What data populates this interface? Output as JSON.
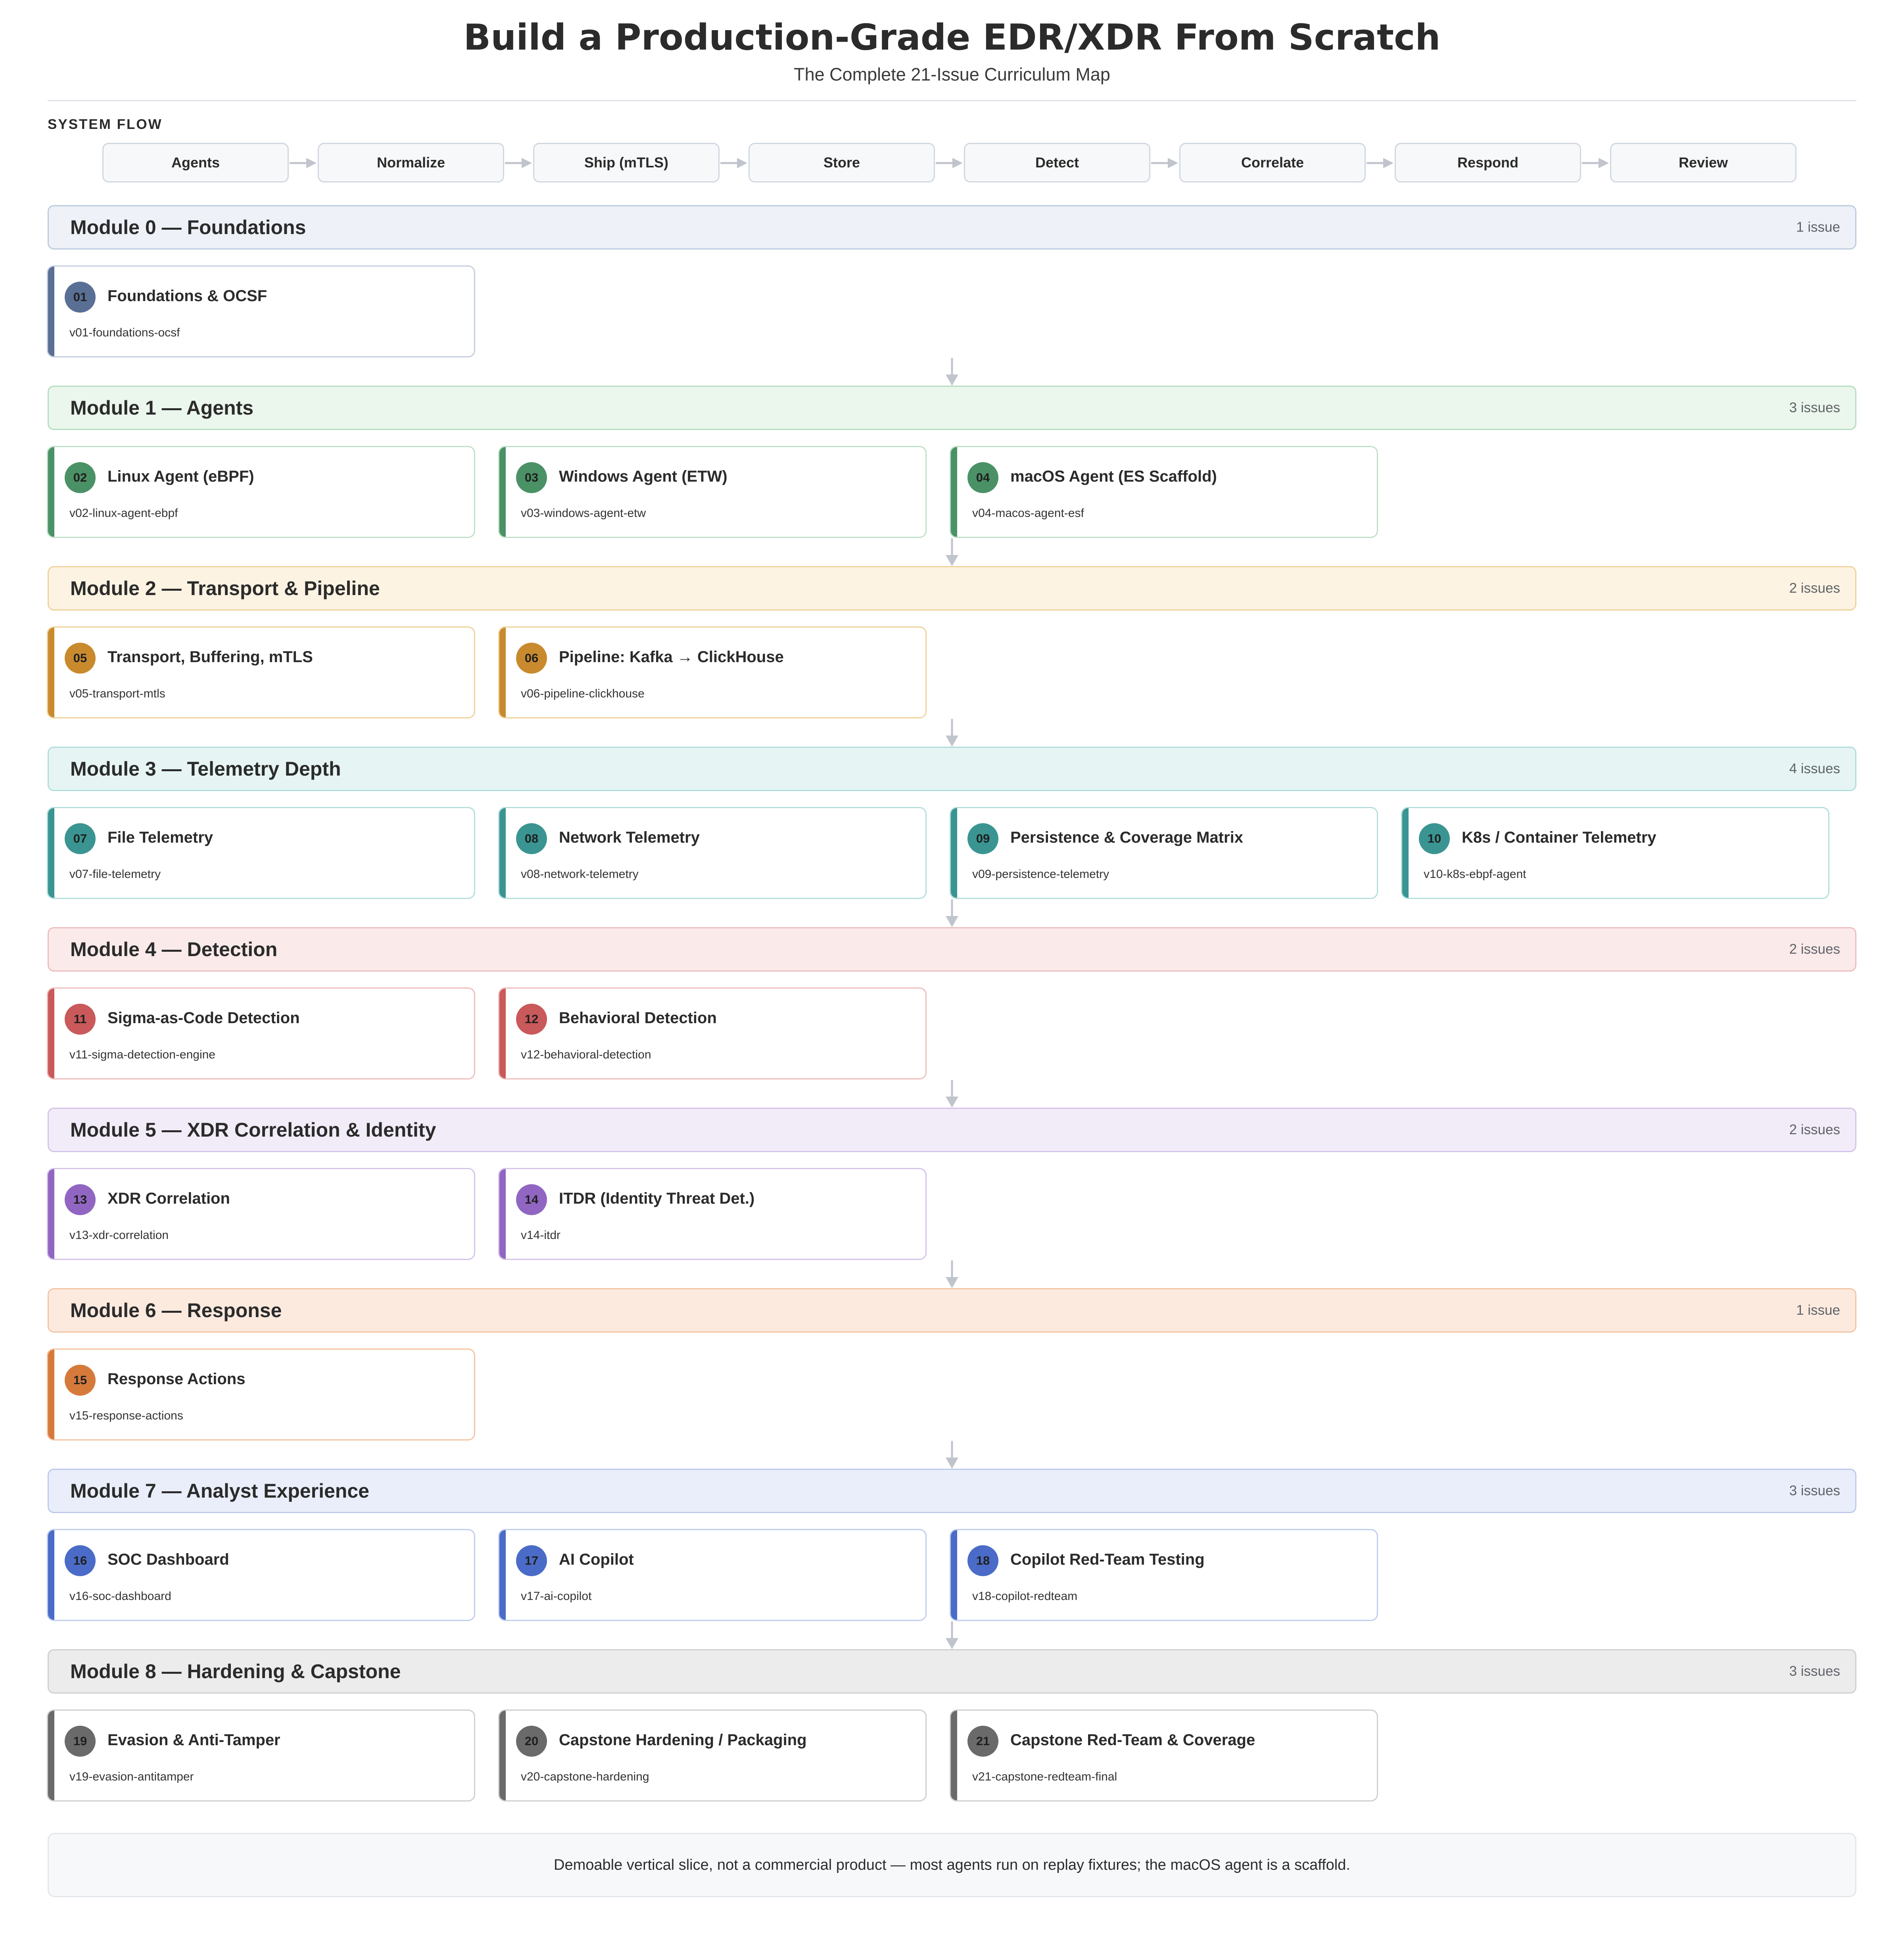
{
  "title": "Build a Production-Grade EDR/XDR From Scratch",
  "subtitle": "The Complete 21-Issue Curriculum Map",
  "flow": {
    "label": "SYSTEM FLOW",
    "steps": [
      "Agents",
      "Normalize",
      "Ship (mTLS)",
      "Store",
      "Detect",
      "Correlate",
      "Respond",
      "Review"
    ]
  },
  "modules": [
    {
      "title": "Module 0 — Foundations",
      "count": "1 issue",
      "colors": {
        "accent": "#5a6f94",
        "header_bg": "#eef1f7",
        "header_border": "#bccbe0",
        "card_border": "#c3cee0"
      },
      "issues": [
        {
          "num": "01",
          "title": "Foundations & OCSF",
          "slug": "v01-foundations-ocsf"
        }
      ]
    },
    {
      "title": "Module 1 — Agents",
      "count": "3 issues",
      "colors": {
        "accent": "#4b9166",
        "header_bg": "#ebf6ed",
        "header_border": "#b7ddbf",
        "card_border": "#bfe0c8"
      },
      "issues": [
        {
          "num": "02",
          "title": "Linux Agent (eBPF)",
          "slug": "v02-linux-agent-ebpf"
        },
        {
          "num": "03",
          "title": "Windows Agent (ETW)",
          "slug": "v03-windows-agent-etw"
        },
        {
          "num": "04",
          "title": "macOS Agent (ES Scaffold)",
          "slug": "v04-macos-agent-esf"
        }
      ]
    },
    {
      "title": "Module 2 — Transport & Pipeline",
      "count": "2 issues",
      "colors": {
        "accent": "#c98a2e",
        "header_bg": "#fdf3e2",
        "header_border": "#f0d29a",
        "card_border": "#f0d29a"
      },
      "issues": [
        {
          "num": "05",
          "title": "Transport, Buffering, mTLS",
          "slug": "v05-transport-mtls"
        },
        {
          "num": "06",
          "title": "Pipeline: Kafka → ClickHouse",
          "slug": "v06-pipeline-clickhouse"
        }
      ]
    },
    {
      "title": "Module 3 — Telemetry Depth",
      "count": "4 issues",
      "colors": {
        "accent": "#3a9592",
        "header_bg": "#e6f5f4",
        "header_border": "#b0dcda",
        "card_border": "#b3dedb"
      },
      "issues": [
        {
          "num": "07",
          "title": "File Telemetry",
          "slug": "v07-file-telemetry"
        },
        {
          "num": "08",
          "title": "Network Telemetry",
          "slug": "v08-network-telemetry"
        },
        {
          "num": "09",
          "title": "Persistence & Coverage Matrix",
          "slug": "v09-persistence-telemetry"
        },
        {
          "num": "10",
          "title": "K8s / Container Telemetry",
          "slug": "v10-k8s-ebpf-agent"
        }
      ]
    },
    {
      "title": "Module 4 — Detection",
      "count": "2 issues",
      "colors": {
        "accent": "#c9595a",
        "header_bg": "#fbeaea",
        "header_border": "#eebcbc",
        "card_border": "#efbcbc"
      },
      "issues": [
        {
          "num": "11",
          "title": "Sigma-as-Code Detection",
          "slug": "v11-sigma-detection-engine"
        },
        {
          "num": "12",
          "title": "Behavioral Detection",
          "slug": "v12-behavioral-detection"
        }
      ]
    },
    {
      "title": "Module 5 — XDR Correlation & Identity",
      "count": "2 issues",
      "colors": {
        "accent": "#9166c2",
        "header_bg": "#f2ecf8",
        "header_border": "#d4c2e9",
        "card_border": "#d5c3ea"
      },
      "issues": [
        {
          "num": "13",
          "title": "XDR Correlation",
          "slug": "v13-xdr-correlation"
        },
        {
          "num": "14",
          "title": "ITDR (Identity Threat Det.)",
          "slug": "v14-itdr"
        }
      ]
    },
    {
      "title": "Module 6 — Response",
      "count": "1 issue",
      "colors": {
        "accent": "#d67a3c",
        "header_bg": "#fdeadf",
        "header_border": "#f4c3a3",
        "card_border": "#f4c3a3"
      },
      "issues": [
        {
          "num": "15",
          "title": "Response Actions",
          "slug": "v15-response-actions"
        }
      ]
    },
    {
      "title": "Module 7 — Analyst Experience",
      "count": "3 issues",
      "colors": {
        "accent": "#4a6cc8",
        "header_bg": "#e9eefa",
        "header_border": "#bcc9ec",
        "card_border": "#c0cdee"
      },
      "issues": [
        {
          "num": "16",
          "title": "SOC Dashboard",
          "slug": "v16-soc-dashboard"
        },
        {
          "num": "17",
          "title": "AI Copilot",
          "slug": "v17-ai-copilot"
        },
        {
          "num": "18",
          "title": "Copilot Red-Team Testing",
          "slug": "v18-copilot-redteam"
        }
      ]
    },
    {
      "title": "Module 8 — Hardening & Capstone",
      "count": "3 issues",
      "colors": {
        "accent": "#6a6a6a",
        "header_bg": "#ececec",
        "header_border": "#cfcfcf",
        "card_border": "#cfcfcf"
      },
      "issues": [
        {
          "num": "19",
          "title": "Evasion & Anti-Tamper",
          "slug": "v19-evasion-antitamper"
        },
        {
          "num": "20",
          "title": "Capstone Hardening / Packaging",
          "slug": "v20-capstone-hardening"
        },
        {
          "num": "21",
          "title": "Capstone Red-Team & Coverage",
          "slug": "v21-capstone-redteam-final"
        }
      ]
    }
  ],
  "footer": "Demoable vertical slice, not a commercial product — most agents run on replay fixtures; the macOS agent is a scaffold.",
  "colors": {
    "flow_arrow": "#c0c4cc",
    "down_arrow": "#c0c4cc",
    "number_text": "#1f1f1f"
  }
}
